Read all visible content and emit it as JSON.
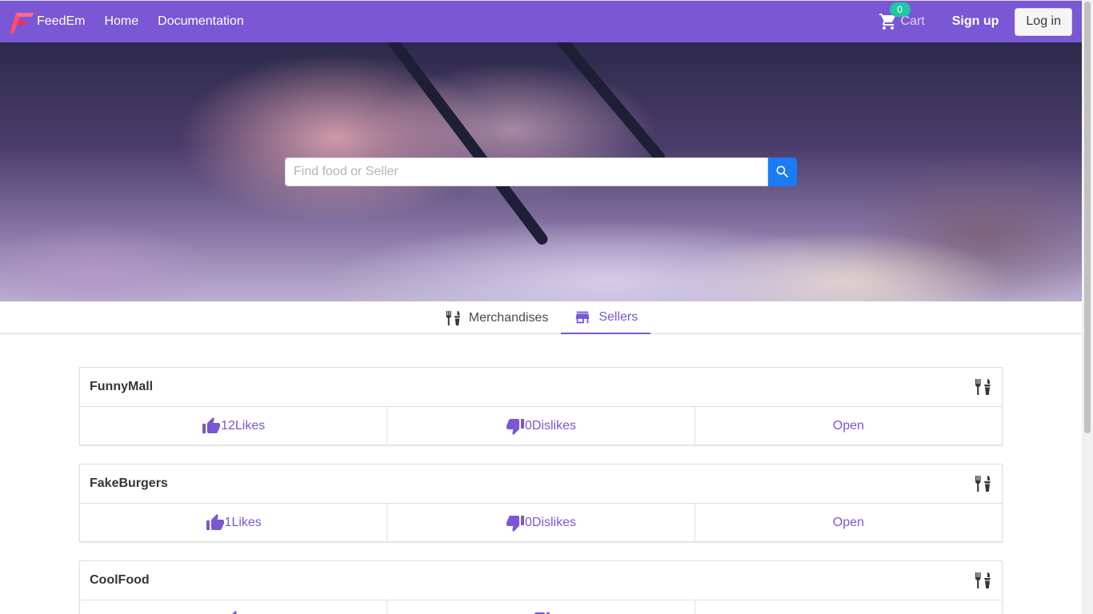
{
  "navbar": {
    "brand": "FeedEm",
    "links": [
      "Home",
      "Documentation"
    ],
    "cart_count": "0",
    "cart_label": "Cart",
    "signup_label": "Sign up",
    "login_label": "Log in"
  },
  "search": {
    "placeholder": "Find food or Seller"
  },
  "tabs": [
    {
      "label": "Merchandises",
      "icon": "utensils-icon",
      "active": false
    },
    {
      "label": "Sellers",
      "icon": "store-icon",
      "active": true
    }
  ],
  "sellers": [
    {
      "name": "FunnyMall",
      "likes": "12",
      "dislikes": "0",
      "action": "Open"
    },
    {
      "name": "FakeBurgers",
      "likes": "1",
      "dislikes": "0",
      "action": "Open"
    },
    {
      "name": "CoolFood",
      "likes": "",
      "dislikes": "",
      "action": ""
    }
  ],
  "labels": {
    "likes_suffix": "Likes",
    "dislikes_suffix": "Dislikes"
  },
  "colors": {
    "primary": "#7957d5",
    "search_button": "#1a7cf5",
    "badge": "#1fc8a0"
  }
}
